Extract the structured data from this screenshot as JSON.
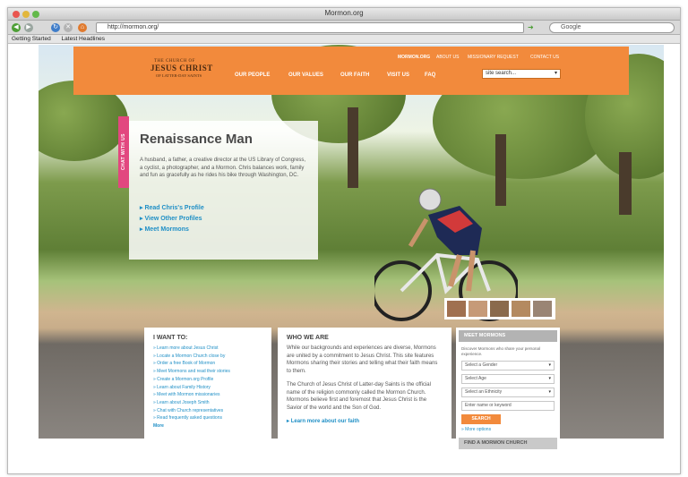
{
  "browser": {
    "window_title": "Mormon.org",
    "url": "http://mormon.org/",
    "search_placeholder": "Google",
    "bookmarks": [
      "Getting Started",
      "Latest Headlines"
    ]
  },
  "site": {
    "logo": {
      "top": "THE CHURCH OF",
      "main": "JESUS CHRIST",
      "bottom": "OF LATTER-DAY SAINTS"
    },
    "top_nav": [
      "MORMON.ORG",
      "ABOUT US",
      "MISSIONARY REQUEST",
      "CONTACT US"
    ],
    "main_nav": [
      "OUR PEOPLE",
      "OUR VALUES",
      "OUR FAITH",
      "VISIT US",
      "FAQ"
    ],
    "search_placeholder": "site search..."
  },
  "feature": {
    "chat_tab": "CHAT WITH US",
    "title": "Renaissance Man",
    "text": "A husband, a father, a creative director at the US Library of Congress, a cyclist, a photographer, and a Mormon. Chris balances work, family and fun as gracefully as he rides his bike through Washington, DC.",
    "links": [
      "Read Chris's Profile",
      "View Other Profiles",
      "Meet Mormons"
    ]
  },
  "thumbnails": {
    "count": 5,
    "colors": [
      "#a07050",
      "#c69a78",
      "#8a6a4c",
      "#b48a60",
      "#9a8574"
    ]
  },
  "i_want_to": {
    "heading": "I WANT TO:",
    "items": [
      "Learn more about Jesus Christ",
      "Locate a Mormon Church close by",
      "Order a free Book of Mormon",
      "Meet Mormons and read their stories",
      "Create a Mormon.org Profile",
      "Learn about Family History",
      "Meet with Mormon missionaries",
      "Learn about Joseph Smith",
      "Chat with Church representatives",
      "Read frequently asked questions"
    ],
    "more": "More"
  },
  "who_we_are": {
    "heading": "WHO WE ARE",
    "para1": "While our backgrounds and experiences are diverse, Mormons are united by a commitment to Jesus Christ. This site features Mormons sharing their stories and telling what their faith means to them.",
    "para2": "The Church of Jesus Christ of Latter-day Saints is the official name of the religion commonly called the Mormon Church. Mormons believe first and foremost that Jesus Christ is the Savior of the world and the Son of God.",
    "more": "Learn more about our faith"
  },
  "meet_mormons": {
    "heading": "MEET MORMONS",
    "intro": "Discover Mormons who share your personal experience.",
    "gender": "Select a Gender",
    "age": "Select Age",
    "ethnicity": "Select an Ethnicity",
    "name_placeholder": "Enter name or keyword",
    "search_button": "SEARCH",
    "more_options": "More options",
    "find_church": "FIND A MORMON CHURCH"
  },
  "colors": {
    "brand_orange": "#f28a3c",
    "link_blue": "#1f8fc6",
    "chat_pink": "#e2477f"
  }
}
